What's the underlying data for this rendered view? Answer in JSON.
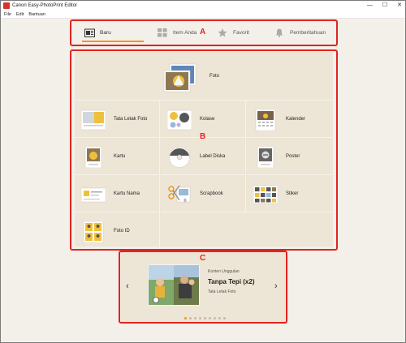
{
  "window": {
    "title": "Canon Easy-PhotoPrint Editor",
    "controls": [
      "—",
      "☐",
      "✕"
    ]
  },
  "menu": [
    "File",
    "Edit",
    "Bantuan"
  ],
  "tabs": [
    {
      "label": "Baru",
      "icon": "new-document-icon",
      "active": true
    },
    {
      "label": "Item Anda",
      "icon": "grid-icon",
      "active": false
    },
    {
      "label": "Favorit",
      "icon": "star-icon",
      "active": false
    },
    {
      "label": "Pemberitahuan",
      "icon": "bell-icon",
      "active": false
    }
  ],
  "annotations": {
    "a": "A",
    "b": "B",
    "c": "C"
  },
  "grid": {
    "foto": "Foto",
    "items": [
      {
        "label": "Tata Letak Foto",
        "icon": "photo-layout-icon"
      },
      {
        "label": "Kolase",
        "icon": "collage-icon"
      },
      {
        "label": "Kalender",
        "icon": "calendar-icon"
      },
      {
        "label": "Kartu",
        "icon": "card-icon"
      },
      {
        "label": "Label Diska",
        "icon": "disc-label-icon"
      },
      {
        "label": "Poster",
        "icon": "poster-icon"
      },
      {
        "label": "Kartu Nama",
        "icon": "business-card-icon"
      },
      {
        "label": "Scrapbook",
        "icon": "scrapbook-icon"
      },
      {
        "label": "Stiker",
        "icon": "sticker-icon"
      },
      {
        "label": "Foto ID",
        "icon": "id-photo-icon"
      }
    ]
  },
  "featured": {
    "subtitle": "Konten Unggulan",
    "title": "Tanpa Tepi (x2)",
    "category": "Tata Letak Foto",
    "prev": "‹",
    "next": "›",
    "dot_count": 9,
    "active_dot": 0
  },
  "colors": {
    "accent": "#e89a23",
    "annotation": "#e0241f",
    "panel": "#ede5d5"
  }
}
